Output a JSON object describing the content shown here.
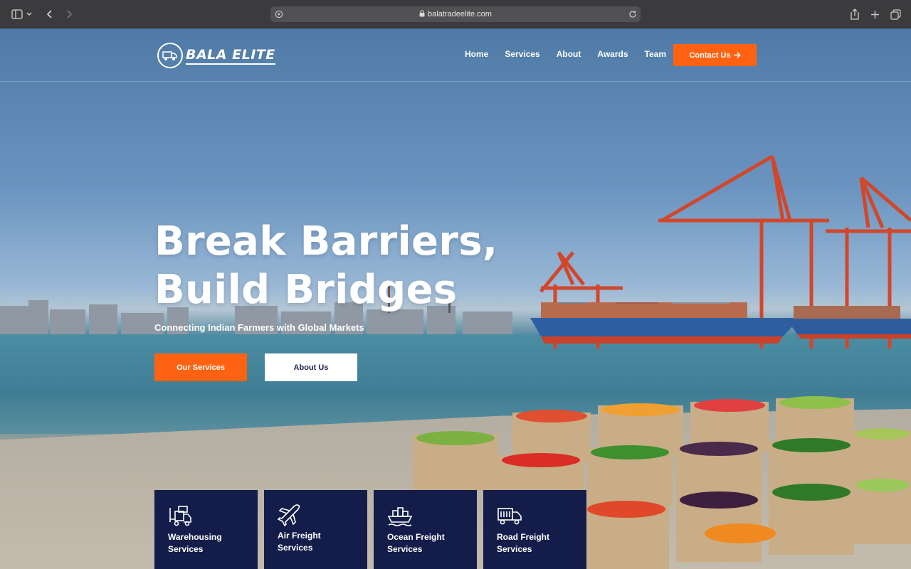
{
  "browser": {
    "url": "balatradeelite.com"
  },
  "brand": {
    "logo_text": "BALA ELITE",
    "accent": "#ff6312",
    "navy": "#141d4a"
  },
  "nav": {
    "home": "Home",
    "services": "Services",
    "about": "About",
    "awards": "Awards",
    "team": "Team",
    "contact": "Contact Us"
  },
  "hero": {
    "title_line1": "Break Barriers,",
    "title_line2": "Build Bridges",
    "subtitle": "Connecting Indian Farmers with Global Markets",
    "primary_button": "Our Services",
    "secondary_button": "About Us"
  },
  "services": [
    {
      "label": "Warehousing\nServices",
      "icon": "forklift-icon"
    },
    {
      "label": "Air Freight\nServices",
      "icon": "airplane-icon"
    },
    {
      "label": "Ocean Freight\nServices",
      "icon": "ship-icon"
    },
    {
      "label": "Road Freight\nServices",
      "icon": "truck-icon"
    }
  ]
}
